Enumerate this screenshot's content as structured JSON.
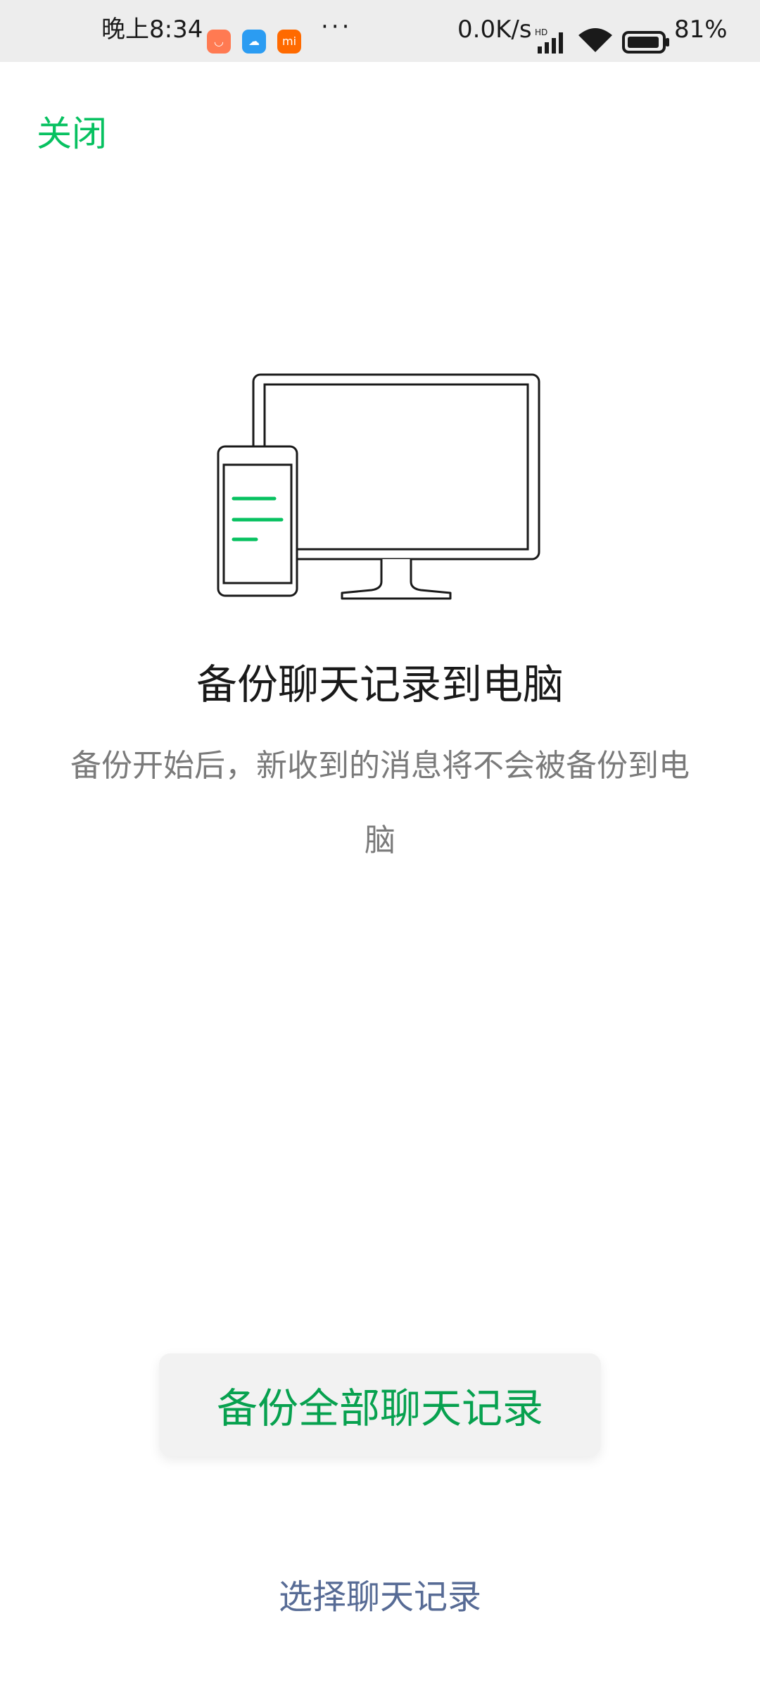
{
  "status_bar": {
    "time": "晚上8:34",
    "more": "···",
    "net_speed": "0.0K/s",
    "battery_percent": "81%",
    "signal_label": "HD",
    "app_icons": [
      "mi-store-icon",
      "cloud-icon",
      "mi-icon"
    ]
  },
  "header": {
    "close_label": "关闭"
  },
  "main": {
    "title": "备份聊天记录到电脑",
    "description": "备份开始后，新收到的消息将不会被备份到电脑"
  },
  "actions": {
    "backup_all_label": "备份全部聊天记录",
    "select_label": "选择聊天记录"
  },
  "colors": {
    "accent_green": "#07c160",
    "link_blue": "#576b95"
  }
}
